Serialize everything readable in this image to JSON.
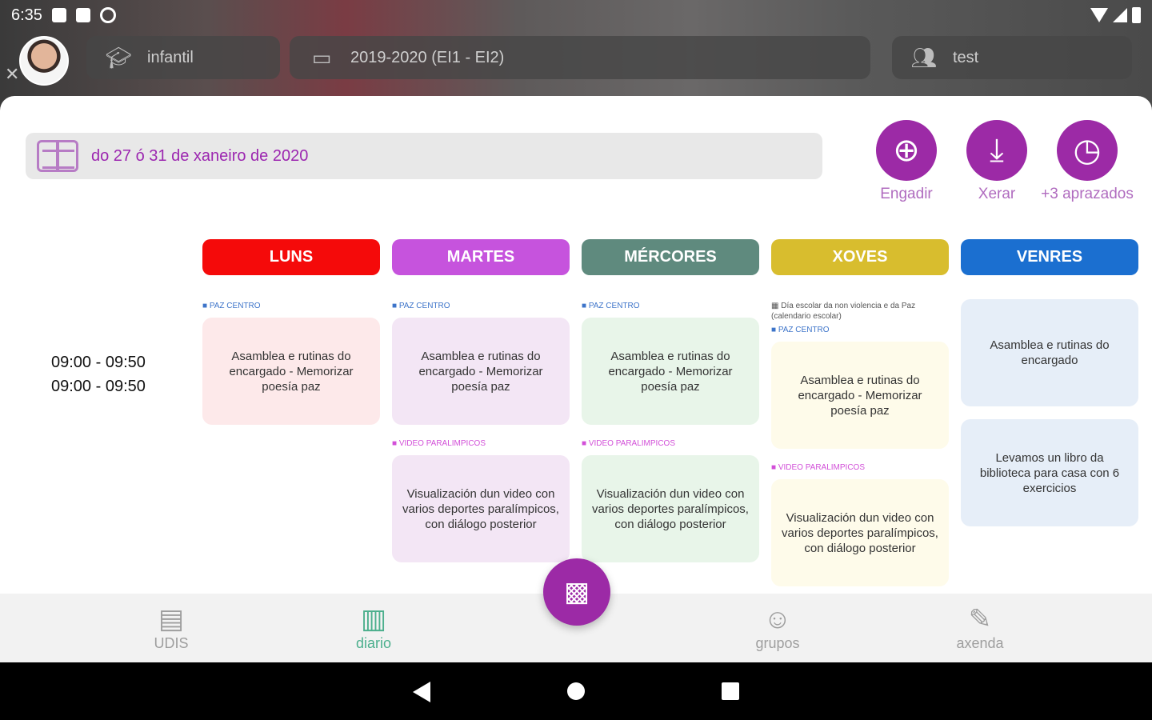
{
  "status": {
    "time": "6:35"
  },
  "header": {
    "stage": {
      "label": "infantil",
      "icon": "graduation-cap-icon"
    },
    "course": {
      "label": "2019-2020 (EI1 - EI2)",
      "icon": "folder-icon"
    },
    "group": {
      "label": "test",
      "icon": "users-icon"
    }
  },
  "week": {
    "label": "do 27  ó 31 de xaneiro de 2020"
  },
  "actions": {
    "add": "Engadir",
    "generate": "Xerar",
    "postponed": "+3 aprazados"
  },
  "time_slot": {
    "line1": "09:00 - 09:50",
    "line2": "09:00 - 09:50"
  },
  "days": [
    {
      "name": "LUNS",
      "color": "#f50a0a",
      "entries": [
        {
          "tag": "■ PAZ CENTRO",
          "text": "Asamblea e rutinas do encargado - Memorizar poesía paz"
        }
      ]
    },
    {
      "name": "MARTES",
      "color": "#c653dd",
      "entries": [
        {
          "tag": "■ PAZ CENTRO",
          "text": "Asamblea e rutinas do encargado - Memorizar poesía paz"
        },
        {
          "tag": "■ VIDEO PARALIMPICOS",
          "text": "Visualización dun video con varios deportes paralímpicos, con diálogo posterior"
        }
      ]
    },
    {
      "name": "MÉRCORES",
      "color": "#5f8a7e",
      "entries": [
        {
          "tag": "■ PAZ CENTRO",
          "text": "Asamblea e rutinas do encargado - Memorizar poesía paz"
        },
        {
          "tag": "■ VIDEO PARALIMPICOS",
          "text": "Visualización dun video con varios deportes paralímpicos, con diálogo posterior"
        }
      ]
    },
    {
      "name": "XOVES",
      "color": "#d8bd2e",
      "note": "Día escolar da non violencia e da Paz (calendario escolar)",
      "entries": [
        {
          "tag": "■ PAZ CENTRO",
          "text": "Asamblea e rutinas do encargado - Memorizar poesía paz"
        },
        {
          "tag": "■ VIDEO PARALIMPICOS",
          "text": "Visualización dun video con varios deportes paralímpicos, con diálogo posterior"
        }
      ]
    },
    {
      "name": "VENRES",
      "color": "#1b6fd0",
      "entries": [
        {
          "text": "Asamblea e rutinas do encargado"
        },
        {
          "text": "Levamos un libro da biblioteca para casa con 6 exercicios"
        }
      ]
    }
  ],
  "bottom_nav": [
    {
      "label": "UDIS",
      "icon": "document-icon"
    },
    {
      "label": "diario",
      "icon": "book-icon",
      "active": true
    },
    {
      "label": "grupos",
      "icon": "users-icon"
    },
    {
      "label": "axenda",
      "icon": "edit-icon"
    }
  ]
}
